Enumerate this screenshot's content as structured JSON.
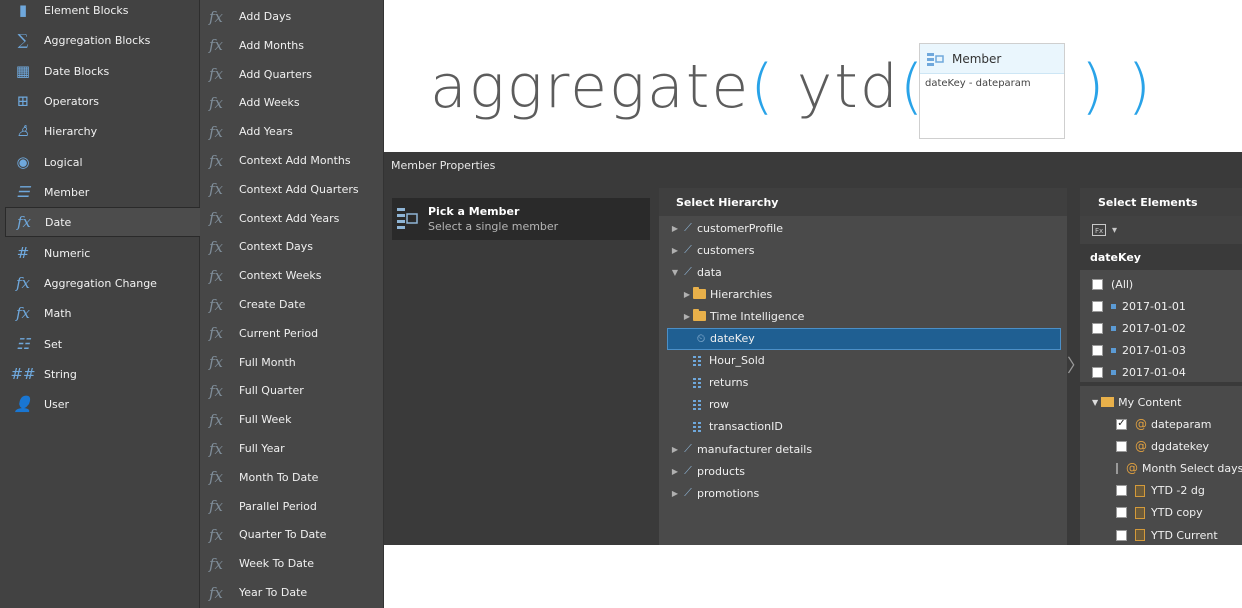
{
  "categories": [
    {
      "label": "Element Blocks",
      "icon": "element-blocks-icon"
    },
    {
      "label": "Aggregation Blocks",
      "icon": "sigma-icon"
    },
    {
      "label": "Date Blocks",
      "icon": "calendar-icon"
    },
    {
      "label": "Operators",
      "icon": "operators-icon"
    },
    {
      "label": "Hierarchy",
      "icon": "hierarchy-icon"
    },
    {
      "label": "Logical",
      "icon": "logical-icon"
    },
    {
      "label": "Member",
      "icon": "member-icon"
    },
    {
      "label": "Date",
      "icon": "date-fx-icon",
      "active": true
    },
    {
      "label": "Numeric",
      "icon": "numeric-icon"
    },
    {
      "label": "Aggregation Change",
      "icon": "fx-icon"
    },
    {
      "label": "Math",
      "icon": "fx-icon"
    },
    {
      "label": "Set",
      "icon": "set-icon"
    },
    {
      "label": "String",
      "icon": "string-icon"
    },
    {
      "label": "User",
      "icon": "user-icon"
    }
  ],
  "functions": [
    "Add Days",
    "Add Months",
    "Add Quarters",
    "Add Weeks",
    "Add Years",
    "Context Add Months",
    "Context Add Quarters",
    "Context Add Years",
    "Context Days",
    "Context Weeks",
    "Create Date",
    "Current Period",
    "Full Month",
    "Full Quarter",
    "Full Week",
    "Full Year",
    "Month To Date",
    "Parallel Period",
    "Quarter To Date",
    "Week To Date",
    "Year To Date"
  ],
  "formula": {
    "fn1": "aggregate",
    "fn2": "ytd",
    "open": "(",
    "close": ")",
    "member_header": "Member",
    "member_value": "dateKey - dateparam"
  },
  "member_properties": {
    "title": "Member Properties",
    "pick_title": "Pick a Member",
    "pick_subtitle": "Select a single member"
  },
  "hierarchy": {
    "header": "Select Hierarchy",
    "rows": [
      {
        "label": "customerProfile",
        "level": 0,
        "type": "dim",
        "twisty": "▶"
      },
      {
        "label": "customers",
        "level": 0,
        "type": "dim",
        "twisty": "▶"
      },
      {
        "label": "data",
        "level": 0,
        "type": "dim",
        "twisty": "▼"
      },
      {
        "label": "Hierarchies",
        "level": 1,
        "type": "folder",
        "twisty": "▶"
      },
      {
        "label": "Time Intelligence",
        "level": 1,
        "type": "folder",
        "twisty": "▶"
      },
      {
        "label": "dateKey",
        "level": 1,
        "type": "datekey",
        "twisty": "",
        "selected": true
      },
      {
        "label": "Hour_Sold",
        "level": 1,
        "type": "attr",
        "twisty": ""
      },
      {
        "label": "returns",
        "level": 1,
        "type": "attr",
        "twisty": ""
      },
      {
        "label": "row",
        "level": 1,
        "type": "attr",
        "twisty": ""
      },
      {
        "label": "transactionID",
        "level": 1,
        "type": "attr",
        "twisty": ""
      },
      {
        "label": "manufacturer details",
        "level": 0,
        "type": "dim",
        "twisty": "▶"
      },
      {
        "label": "products",
        "level": 0,
        "type": "dim",
        "twisty": "▶"
      },
      {
        "label": "promotions",
        "level": 0,
        "type": "dim",
        "twisty": "▶"
      }
    ]
  },
  "elements": {
    "header": "Select Elements",
    "tool_label": "▾",
    "dimension": "dateKey",
    "items": [
      {
        "label": "(All)",
        "checked": false,
        "marker": "none"
      },
      {
        "label": "2017-01-01",
        "checked": false,
        "marker": "square"
      },
      {
        "label": "2017-01-02",
        "checked": false,
        "marker": "square"
      },
      {
        "label": "2017-01-03",
        "checked": false,
        "marker": "square"
      },
      {
        "label": "2017-01-04",
        "checked": false,
        "marker": "square"
      }
    ],
    "content_folder": "My Content",
    "content_items": [
      {
        "label": "dateparam",
        "checked": true,
        "marker": "param"
      },
      {
        "label": "dgdatekey",
        "checked": false,
        "marker": "param"
      },
      {
        "label": "Month Select days",
        "checked": false,
        "marker": "param"
      },
      {
        "label": "YTD -2 dg",
        "checked": false,
        "marker": "calc"
      },
      {
        "label": "YTD copy",
        "checked": false,
        "marker": "calc"
      },
      {
        "label": "YTD Current",
        "checked": false,
        "marker": "calc"
      }
    ]
  },
  "colors": {
    "accent": "#29a3e8",
    "selection": "#1f5f92",
    "panel": "#3a3a3a"
  }
}
